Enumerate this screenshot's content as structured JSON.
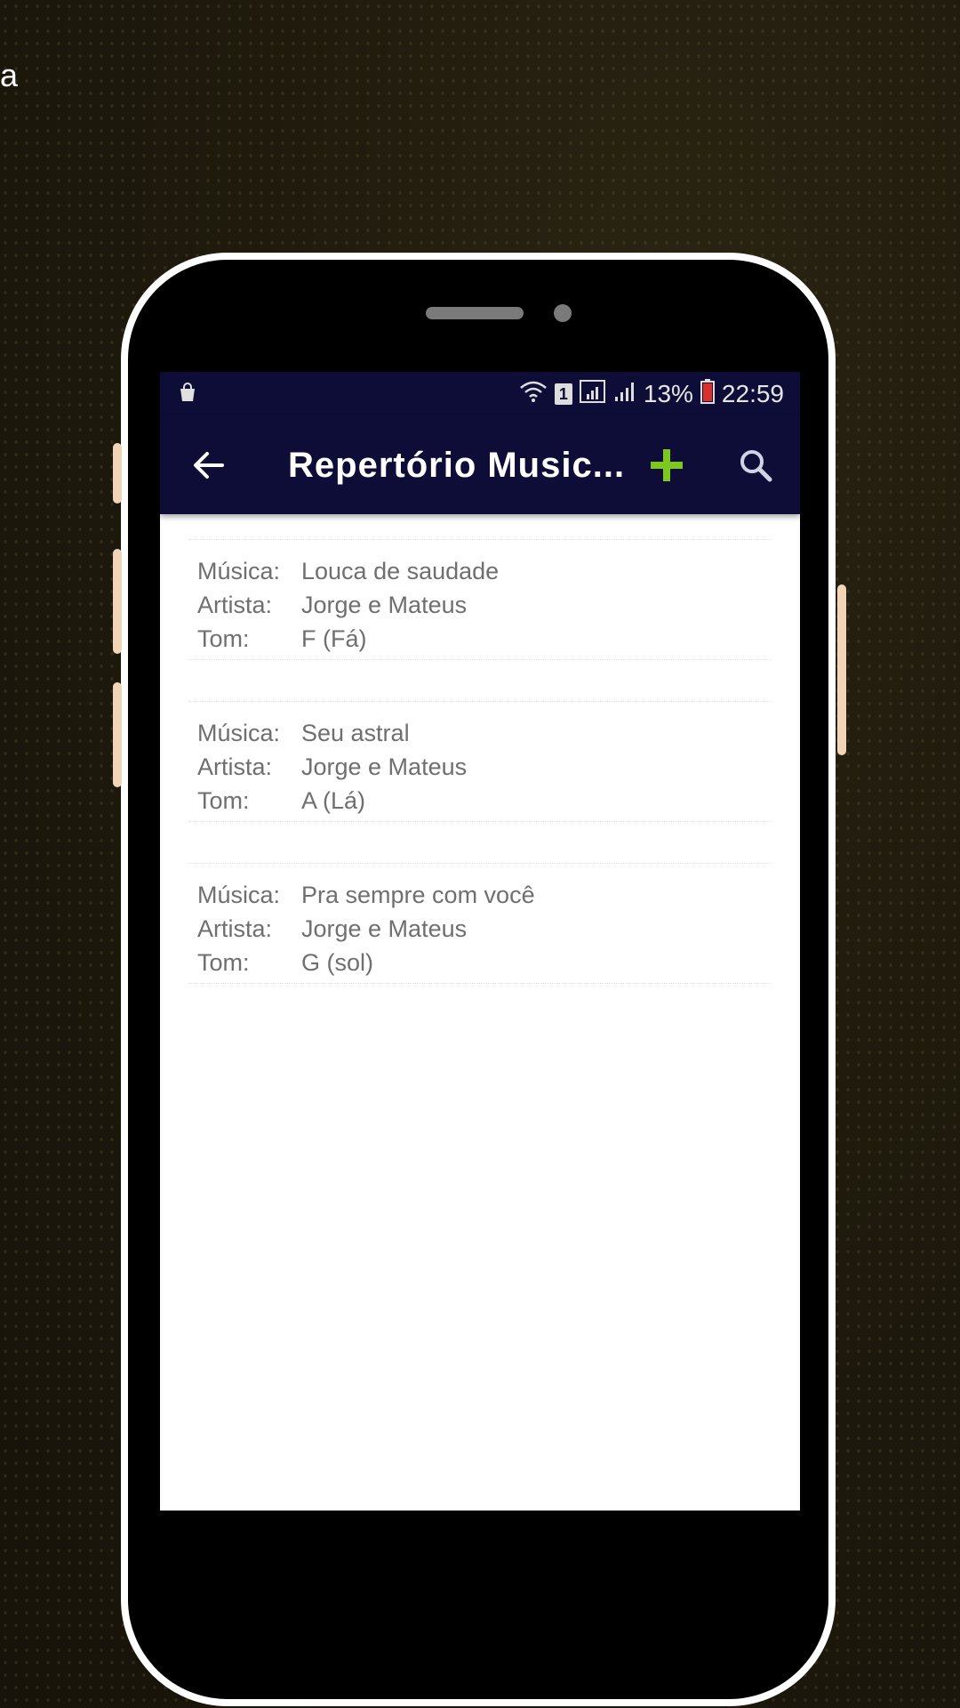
{
  "background": {
    "letter": "a"
  },
  "status_bar": {
    "battery": "13%",
    "time": "22:59",
    "sim_label": "1",
    "icons": [
      "bag-icon",
      "wifi-icon",
      "sim-icon",
      "signal-icon",
      "signal-icon",
      "battery-icon"
    ]
  },
  "app_bar": {
    "title": "Repertório Music...",
    "back_icon": "arrow-left-icon",
    "add_icon": "plus-icon",
    "search_icon": "search-icon",
    "colors": {
      "bar": "#0d0d38",
      "add": "#7dc81e"
    }
  },
  "labels": {
    "musica": "Música:",
    "artista": "Artista:",
    "tom": "Tom:"
  },
  "songs": [
    {
      "musica": "Louca de saudade",
      "artista": "Jorge e Mateus",
      "tom": "F (Fá)"
    },
    {
      "musica": "Seu astral",
      "artista": "Jorge e Mateus",
      "tom": "A (Lá)"
    },
    {
      "musica": "Pra sempre com você",
      "artista": "Jorge e Mateus",
      "tom": "G (sol)"
    }
  ]
}
